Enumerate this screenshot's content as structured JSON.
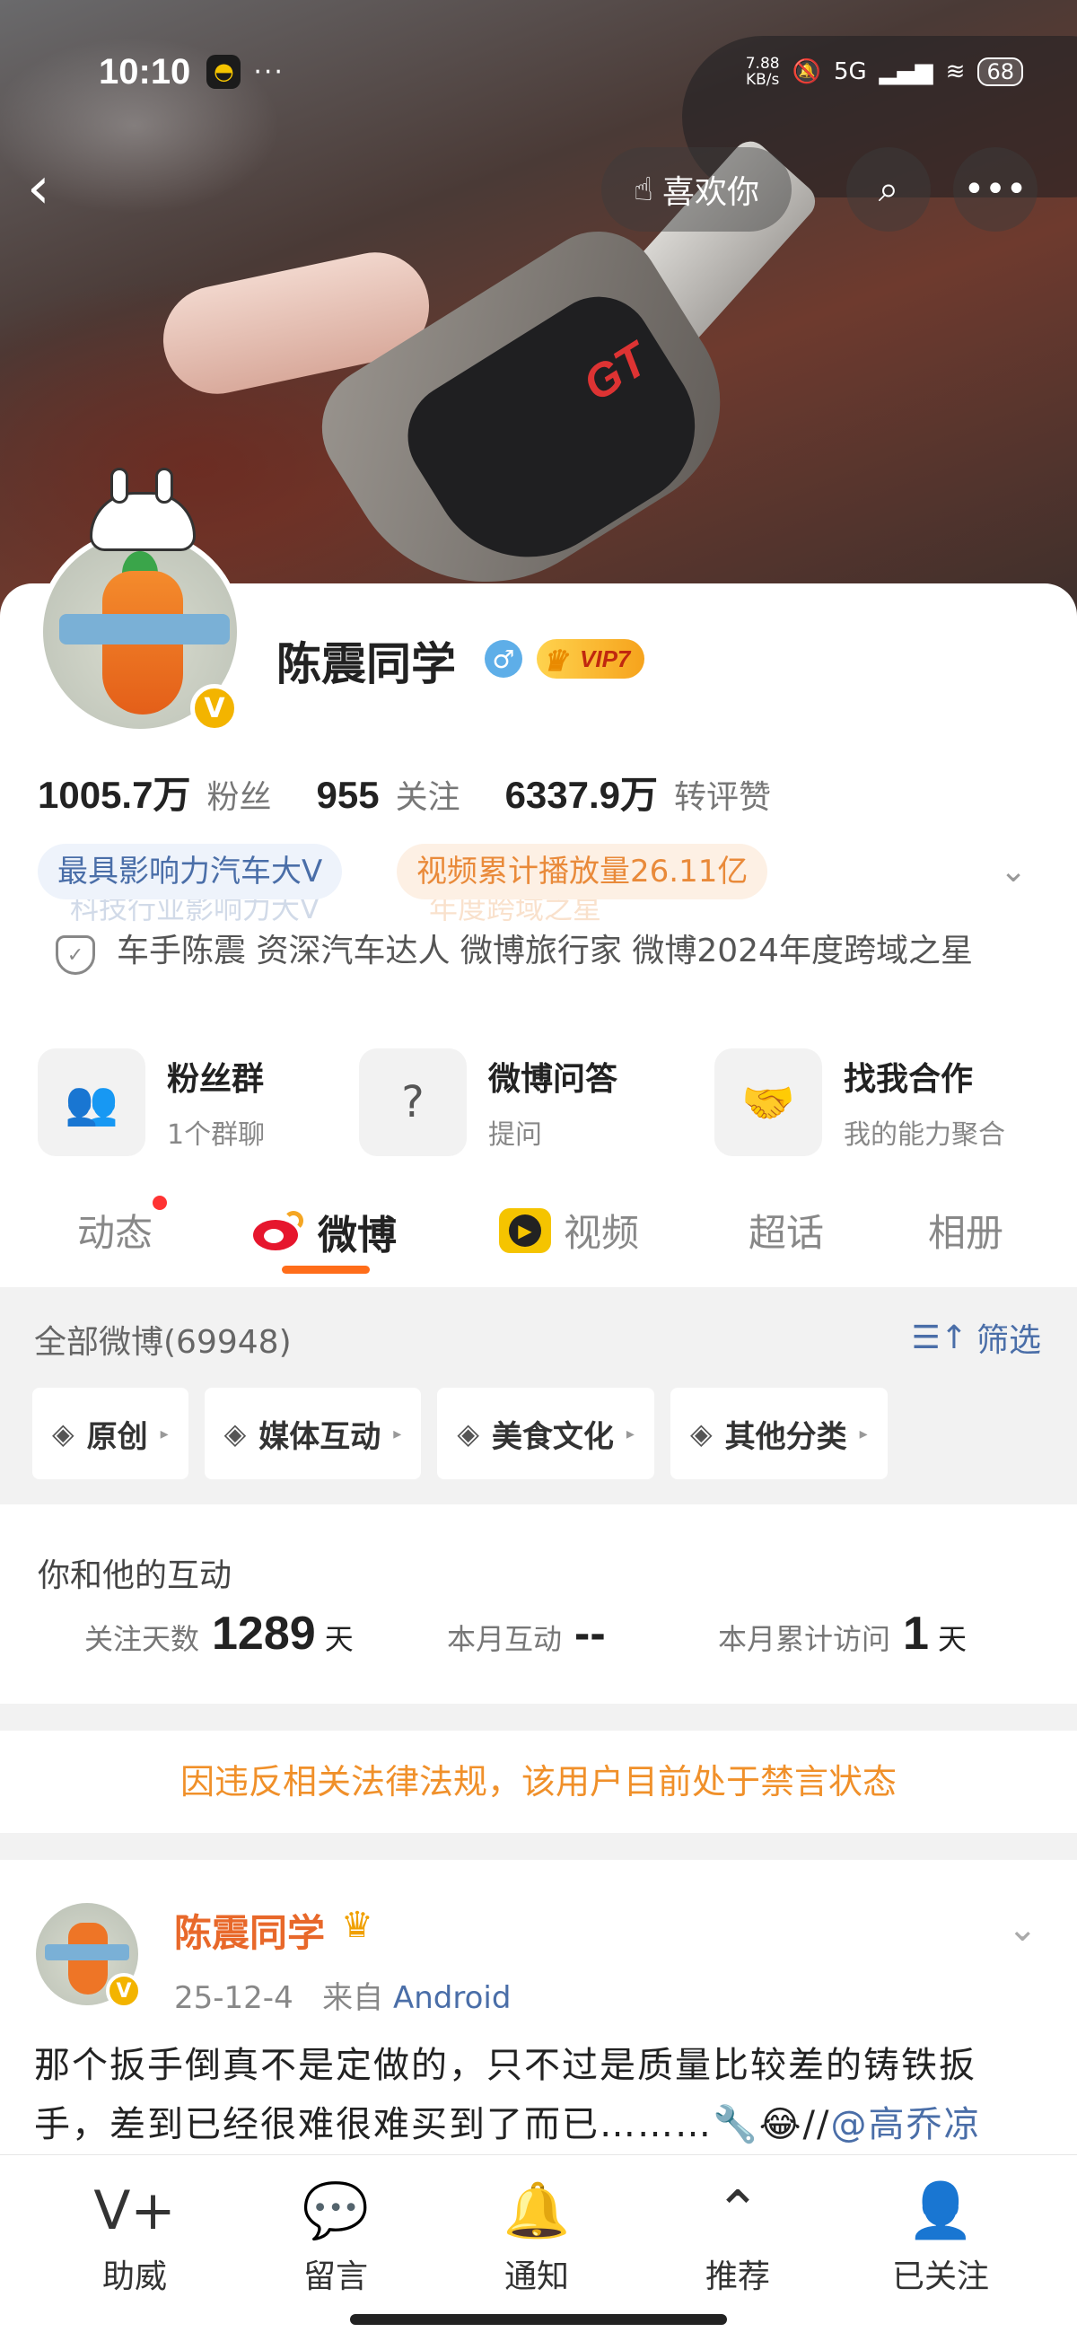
{
  "status_bar": {
    "time": "10:10",
    "dots": "···",
    "speed_value": "7.88",
    "speed_unit": "KB/s",
    "network": "5G",
    "battery": "68"
  },
  "cover": {
    "key_label": "GT"
  },
  "header": {
    "like_label": "喜欢你"
  },
  "profile": {
    "name": "陈震同学",
    "gender_symbol": "♂",
    "vip_label": "VIP7",
    "stats": [
      {
        "value": "1005.7万",
        "label": "粉丝"
      },
      {
        "value": "955",
        "label": "关注"
      },
      {
        "value": "6337.9万",
        "label": "转评赞"
      }
    ],
    "tags": {
      "blue": "最具影响力汽车大V",
      "orange": "视频累计播放量26.11亿",
      "ghost_blue": "科技行业影响力大V",
      "ghost_orange": "年度跨域之星"
    },
    "description": "车手陈震 资深汽车达人  微博旅行家 微博2024年度跨域之星"
  },
  "quick_entries": [
    {
      "title": "粉丝群",
      "sub": "1个群聊"
    },
    {
      "title": "微博问答",
      "sub": "提问"
    },
    {
      "title": "找我合作",
      "sub": "我的能力聚合"
    }
  ],
  "tabs": [
    "动态",
    "微博",
    "视频",
    "超话",
    "相册"
  ],
  "feed": {
    "all_label": "全部微博(69948)",
    "filter_label": "筛选",
    "chips": [
      "原创",
      "媒体互动",
      "美食文化",
      "其他分类"
    ]
  },
  "interaction": {
    "heading": "你和他的互动",
    "follow_days_label": "关注天数",
    "follow_days_value": "1289",
    "follow_days_unit": "天",
    "month_label": "本月互动",
    "month_value": "--",
    "visits_label": "本月累计访问",
    "visits_value": "1",
    "visits_unit": "天"
  },
  "banned_notice": "因违反相关法律法规，该用户目前处于禁言状态",
  "post": {
    "author": "陈震同学",
    "date": "25-12-4",
    "from_label": "来自",
    "source": "Android",
    "text": "那个扳手倒真不是定做的，只不过是质量比较差的铸铁扳手，差到已经很难很难买到了而已………🔧😂//",
    "mention": "@高乔凉"
  },
  "bottom_nav": [
    {
      "icon": "V+",
      "label": "助威"
    },
    {
      "icon": "💬",
      "label": "留言"
    },
    {
      "icon": "🔔",
      "label": "通知"
    },
    {
      "icon": "⌃",
      "label": "推荐"
    },
    {
      "icon": "👤",
      "label": "已关注"
    }
  ]
}
